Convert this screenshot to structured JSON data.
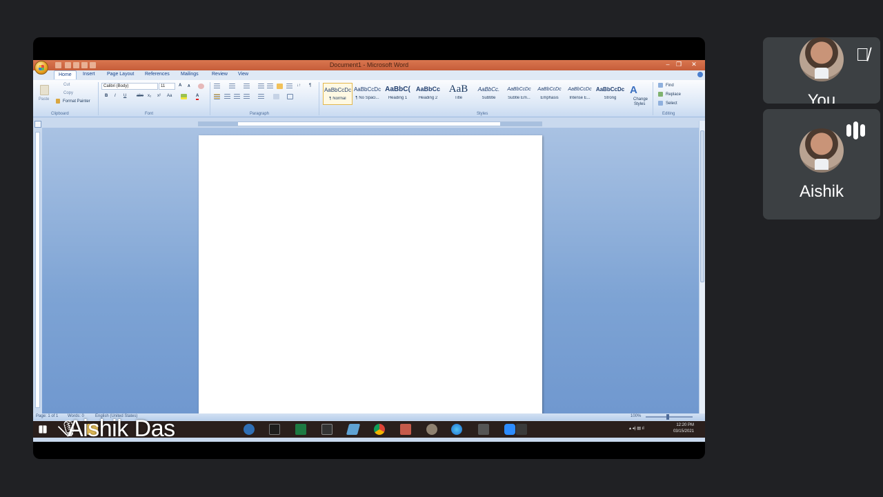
{
  "window": {
    "title": "Document1 - Microsoft Word",
    "controls": {
      "minimize": "–",
      "restore": "❐",
      "close": "✕"
    }
  },
  "tabs": [
    "Home",
    "Insert",
    "Page Layout",
    "References",
    "Mailings",
    "Review",
    "View"
  ],
  "ribbon": {
    "clipboard": {
      "label": "Clipboard",
      "paste": "Paste",
      "cut": "Cut",
      "copy": "Copy",
      "format_painter": "Format Painter"
    },
    "font": {
      "label": "Font",
      "font_name": "Calibri (Body)",
      "font_size": "11",
      "case_label": "Aa"
    },
    "paragraph": {
      "label": "Paragraph"
    },
    "styles": {
      "label": "Styles",
      "items": [
        {
          "sample": "AaBbCcDc",
          "name": "¶ Normal"
        },
        {
          "sample": "AaBbCcDc",
          "name": "¶ No Spaci..."
        },
        {
          "sample": "AaBbC(",
          "name": "Heading 1"
        },
        {
          "sample": "AaBbCc",
          "name": "Heading 2"
        },
        {
          "sample": "AaB",
          "name": "Title"
        },
        {
          "sample": "AaBbCc.",
          "name": "Subtitle"
        },
        {
          "sample": "AaBbCcDc",
          "name": "Subtle Em..."
        },
        {
          "sample": "AaBbCcDc",
          "name": "Emphasis"
        },
        {
          "sample": "AaBbCcDc",
          "name": "Intense E..."
        },
        {
          "sample": "AaBbCcDc",
          "name": "Strong"
        }
      ],
      "change_styles_line1": "Change",
      "change_styles_line2": "Styles"
    },
    "editing": {
      "label": "Editing",
      "find": "Find",
      "replace": "Replace",
      "select": "Select"
    }
  },
  "statusbar": {
    "page": "Page: 1 of 1",
    "words": "Words: 0",
    "language": "English (United States)",
    "zoom": "100%"
  },
  "taskbar": {
    "time": "12:20 PM",
    "date": "03/15/2021"
  },
  "presenter": {
    "name": "Aishik Das"
  },
  "participants": [
    {
      "name": "You",
      "muted": true
    },
    {
      "name": "Aishik",
      "speaking": true
    }
  ],
  "colors": {
    "title_bar": "#c65d3a",
    "ribbon": "#dbe7f6",
    "document_bg": "#7da3d4",
    "taskbar": "#2a1f1c",
    "meet_bg": "#202124",
    "tile": "#3c4043"
  }
}
